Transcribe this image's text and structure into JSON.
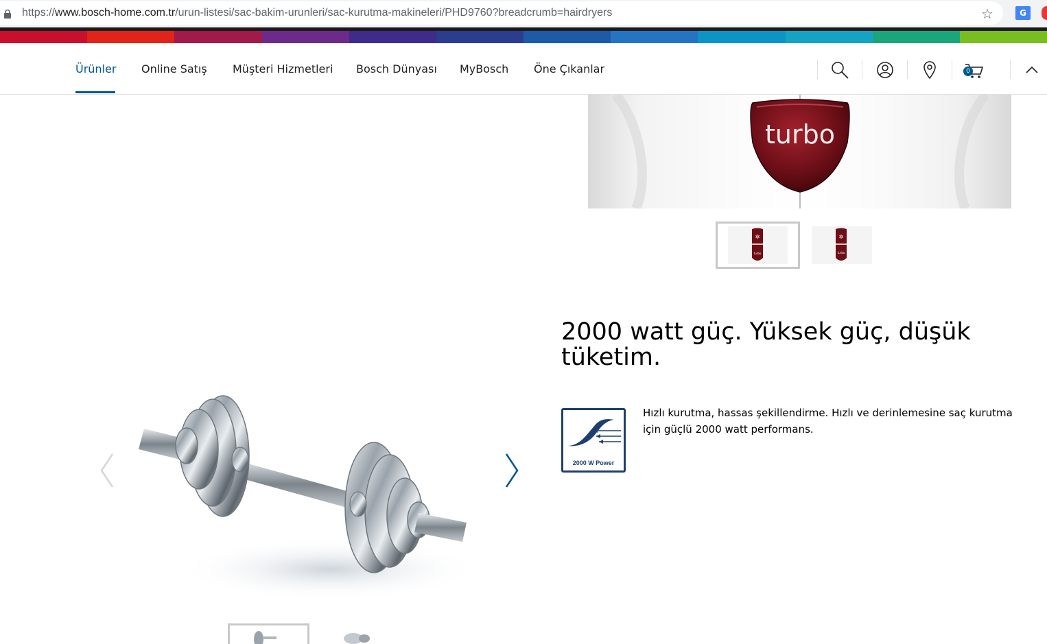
{
  "browser": {
    "url_scheme": "https://",
    "url_host": "www.bosch-home.com.tr",
    "url_path": "/urun-listesi/sac-bakim-urunleri/sac-kurutma-makineleri/PHD9760?breadcrumb=hairdryers",
    "icons": [
      "lock-icon",
      "star-icon",
      "google-translate-icon"
    ]
  },
  "supergraphic": {
    "colors": [
      "#c8102e",
      "#e2231a",
      "#a21a4a",
      "#6c2a8c",
      "#3f2b8c",
      "#2b3d8f",
      "#1d5aa8",
      "#2574c4",
      "#0d94c6",
      "#15a3c4",
      "#1ba57a",
      "#78be20"
    ]
  },
  "nav": {
    "items": [
      {
        "label": "Ürünler",
        "active": true
      },
      {
        "label": "Online Satış"
      },
      {
        "label": "Müşteri Hizmetleri"
      },
      {
        "label": "Bosch Dünyası"
      },
      {
        "label": "MyBosch"
      },
      {
        "label": "Öne Çıkanlar"
      }
    ],
    "icons": [
      "search-icon",
      "user-icon",
      "location-pin-icon",
      "cart-icon",
      "chevron-up-icon"
    ],
    "cart_count": "0",
    "accent": "#005691"
  },
  "turbo_gallery": {
    "button_text": "turbo",
    "thumb_labels": [
      "turbo",
      "turbo"
    ],
    "selected_thumb": 0
  },
  "feature": {
    "headline": "2000 watt güç. Yüksek güç, düşük tüketim.",
    "icon_label": "2000 W Power",
    "description": "Hızlı kurutma, hassas şekillendirme. Hızlı ve derinlemesine saç kurutma için güçlü 2000 watt performans."
  },
  "image_gallery": {
    "arrows": [
      "chevron-left-icon",
      "chevron-right-icon"
    ],
    "selected_thumb": 0
  }
}
